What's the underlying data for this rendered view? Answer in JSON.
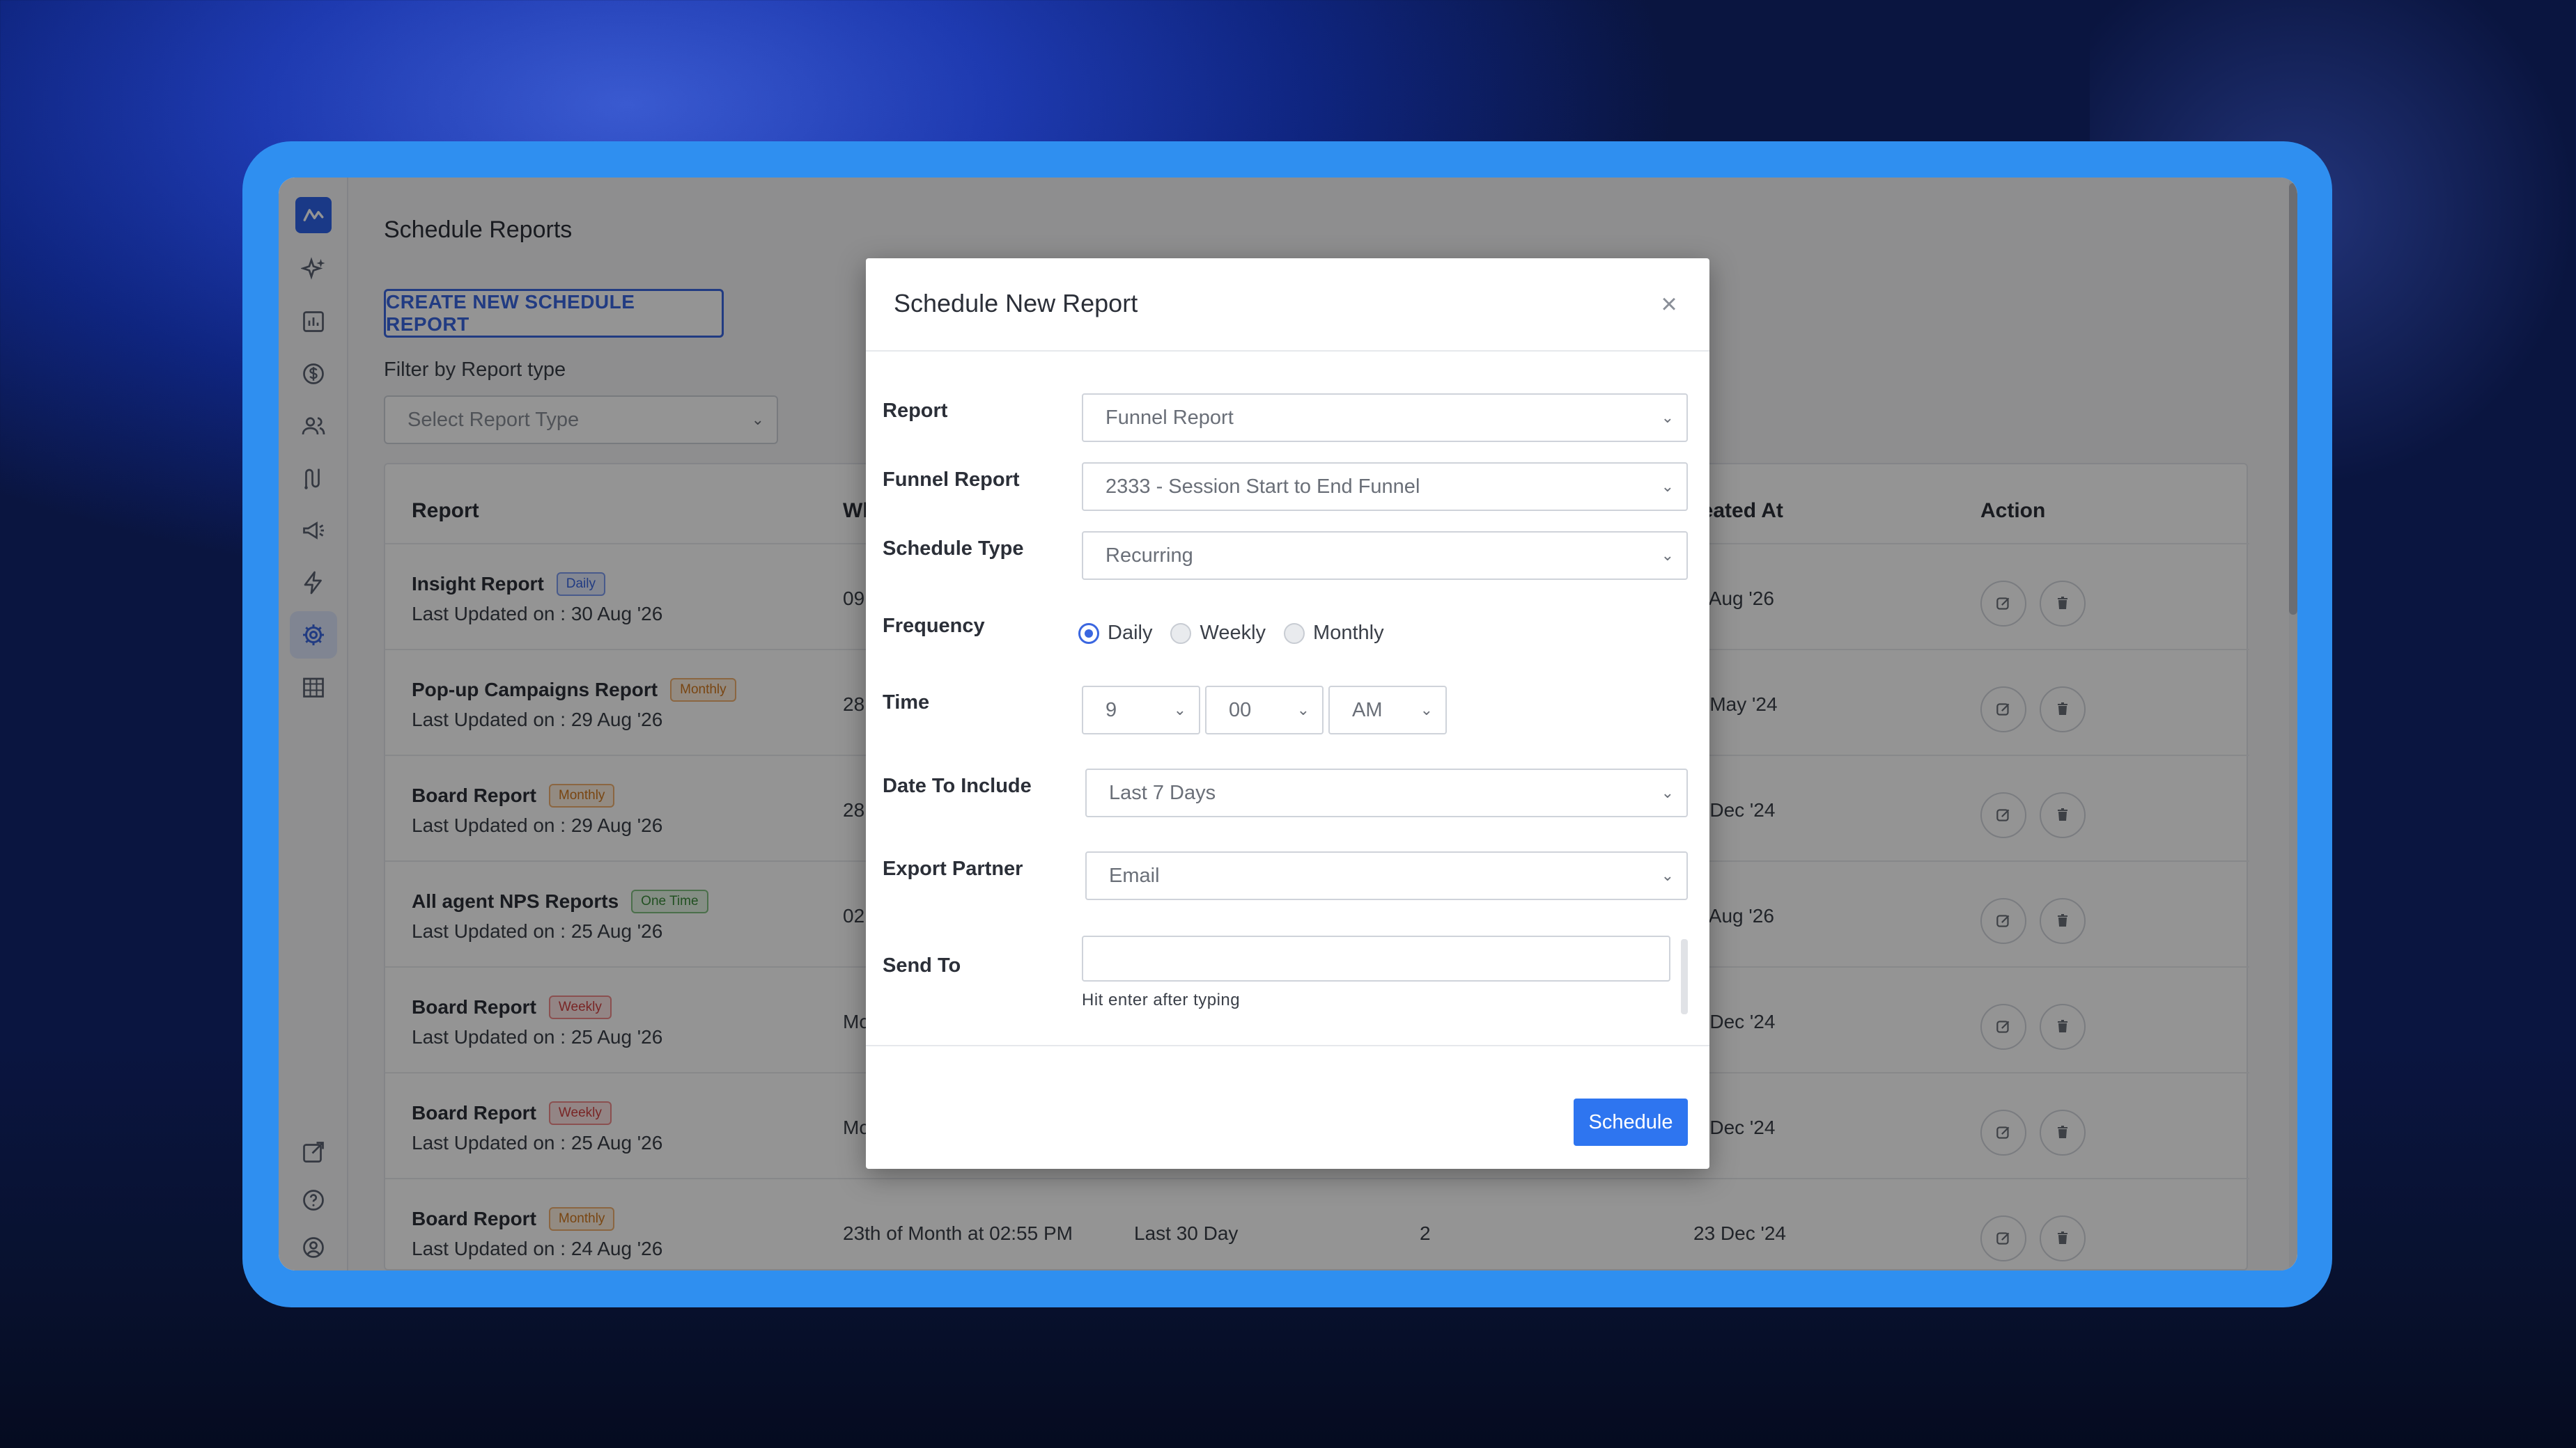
{
  "page": {
    "title": "Schedule Reports",
    "create_button": "CREATE NEW SCHEDULE REPORT",
    "filter_label": "Filter by Report type",
    "filter_placeholder": "Select Report Type"
  },
  "sidebar": {
    "icons": [
      "logo-icon",
      "sparkle-icon",
      "chart-icon",
      "dollar-icon",
      "users-icon",
      "journey-icon",
      "megaphone-icon",
      "lightning-icon",
      "gear-icon",
      "building-icon",
      "external-link-icon",
      "help-icon",
      "account-icon"
    ],
    "active": "gear-icon"
  },
  "table": {
    "headers": {
      "report": "Report",
      "when": "Wh",
      "created_at": "reated At",
      "action": "Action"
    },
    "rows": [
      {
        "name": "Insight Report",
        "badge": "Daily",
        "badge_type": "daily",
        "updated": "Last Updated on : 30 Aug '26",
        "when": "09",
        "date_range": "",
        "count": "",
        "created": "2 Aug '26"
      },
      {
        "name": "Pop-up Campaigns Report",
        "badge": "Monthly",
        "badge_type": "monthly",
        "updated": "Last Updated on : 29 Aug '26",
        "when": "28",
        "date_range": "",
        "count": "",
        "created": "6 May '24"
      },
      {
        "name": "Board Report",
        "badge": "Monthly",
        "badge_type": "monthly",
        "updated": "Last Updated on : 29 Aug '26",
        "when": "28",
        "date_range": "",
        "count": "",
        "created": "0 Dec '24"
      },
      {
        "name": "All agent NPS Reports",
        "badge": "One Time",
        "badge_type": "onetime",
        "updated": "Last Updated on : 25 Aug '26",
        "when": "02",
        "date_range": "",
        "count": "",
        "created": "5 Aug '26"
      },
      {
        "name": "Board Report",
        "badge": "Weekly",
        "badge_type": "weekly",
        "updated": "Last Updated on : 25 Aug '26",
        "when": "Mc",
        "date_range": "",
        "count": "",
        "created": "3 Dec '24"
      },
      {
        "name": "Board Report",
        "badge": "Weekly",
        "badge_type": "weekly",
        "updated": "Last Updated on : 25 Aug '26",
        "when": "Mc",
        "date_range": "",
        "count": "",
        "created": "0 Dec '24"
      },
      {
        "name": "Board Report",
        "badge": "Monthly",
        "badge_type": "monthly",
        "updated": "Last Updated on : 24 Aug '26",
        "when": "23th of Month at 02:55 PM",
        "date_range": "Last 30 Day",
        "count": "2",
        "created": "23 Dec '24"
      }
    ]
  },
  "modal": {
    "title": "Schedule New Report",
    "close": "×",
    "fields": {
      "report_label": "Report",
      "report_value": "Funnel Report",
      "funnel_label": "Funnel Report",
      "funnel_value": "2333 - Session Start to End Funnel",
      "schedule_type_label": "Schedule Type",
      "schedule_type_value": "Recurring",
      "frequency_label": "Frequency",
      "frequency_options": [
        "Daily",
        "Weekly",
        "Monthly"
      ],
      "frequency_selected": "Daily",
      "time_label": "Time",
      "time_hour": "9",
      "time_minute": "00",
      "time_ampm": "AM",
      "date_label": "Date To Include",
      "date_value": "Last 7 Days",
      "export_label": "Export Partner",
      "export_value": "Email",
      "send_label": "Send To",
      "send_hint": "Hit enter after typing"
    },
    "submit": "Schedule"
  },
  "colors": {
    "accent": "#2e75f0",
    "frame": "#2f8ff0",
    "primary_text": "#2b2f38"
  }
}
